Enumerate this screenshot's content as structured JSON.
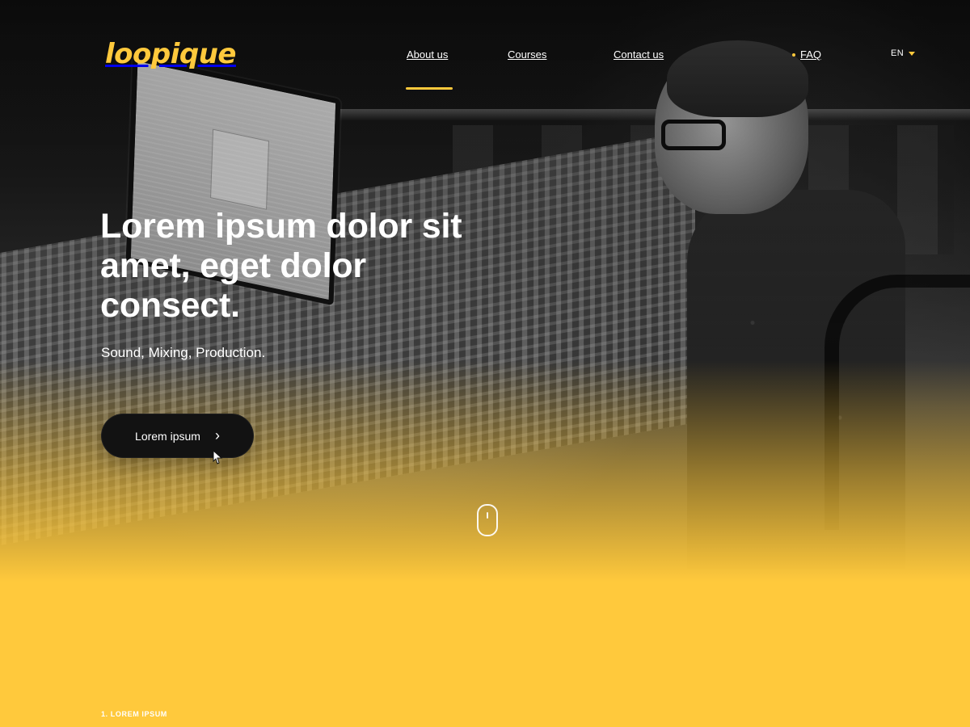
{
  "brand": {
    "name": "loopique",
    "accent_color": "#ffc93c"
  },
  "nav": {
    "items": [
      {
        "label": "About us",
        "active": true
      },
      {
        "label": "Courses"
      },
      {
        "label": "Contact us"
      },
      {
        "label": "FAQ"
      }
    ],
    "language": {
      "selected": "EN"
    }
  },
  "hero": {
    "title": "Lorem ipsum dolor sit amet, eget dolor consect.",
    "subtitle": "Sound, Mixing, Production.",
    "cta": {
      "label": "Lorem ipsum",
      "icon": "chevron-right-icon"
    },
    "scroll_icon": "mouse-scroll-icon"
  },
  "section": {
    "label": "1. LOREM IPSUM"
  },
  "colors": {
    "yellow": "#ffc93c",
    "button_dark": "#121212",
    "text_light": "#ffffff"
  }
}
